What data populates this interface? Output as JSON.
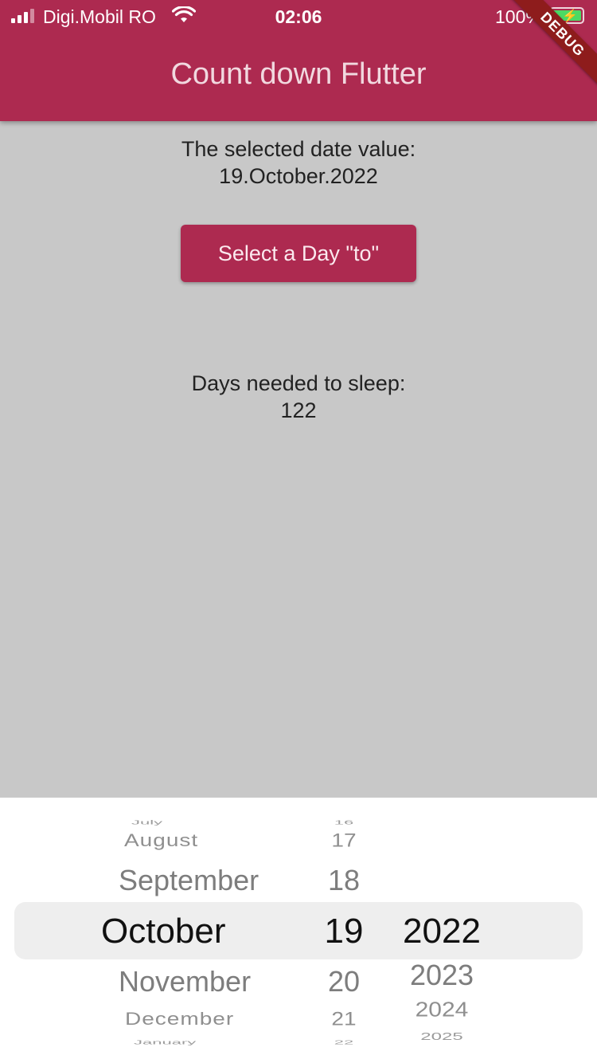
{
  "status_bar": {
    "carrier": "Digi.Mobil RO",
    "time": "02:06",
    "battery_percent": "100%",
    "icons": [
      "signal-icon",
      "wifi-icon",
      "battery-charging-icon"
    ]
  },
  "app_bar": {
    "title": "Count down Flutter",
    "debug_banner": "DEBUG"
  },
  "main": {
    "selected_label": "The selected date value:",
    "selected_value": "19.October.2022",
    "select_button": "Select a Day \"to\"",
    "days_label": "Days needed to sleep:",
    "days_value": "122"
  },
  "picker": {
    "months": [
      "July",
      "August",
      "September",
      "October",
      "November",
      "December",
      "January"
    ],
    "days": [
      "16",
      "17",
      "18",
      "19",
      "20",
      "21",
      "22"
    ],
    "years": [
      "2022",
      "2023",
      "2024",
      "2025"
    ],
    "selected": {
      "month": "October",
      "day": "19",
      "year": "2022"
    }
  },
  "colors": {
    "accent": "#ad2a50",
    "background": "#c8c8c8",
    "picker_background": "#ffffff",
    "selection_band": "#eeeeee"
  }
}
